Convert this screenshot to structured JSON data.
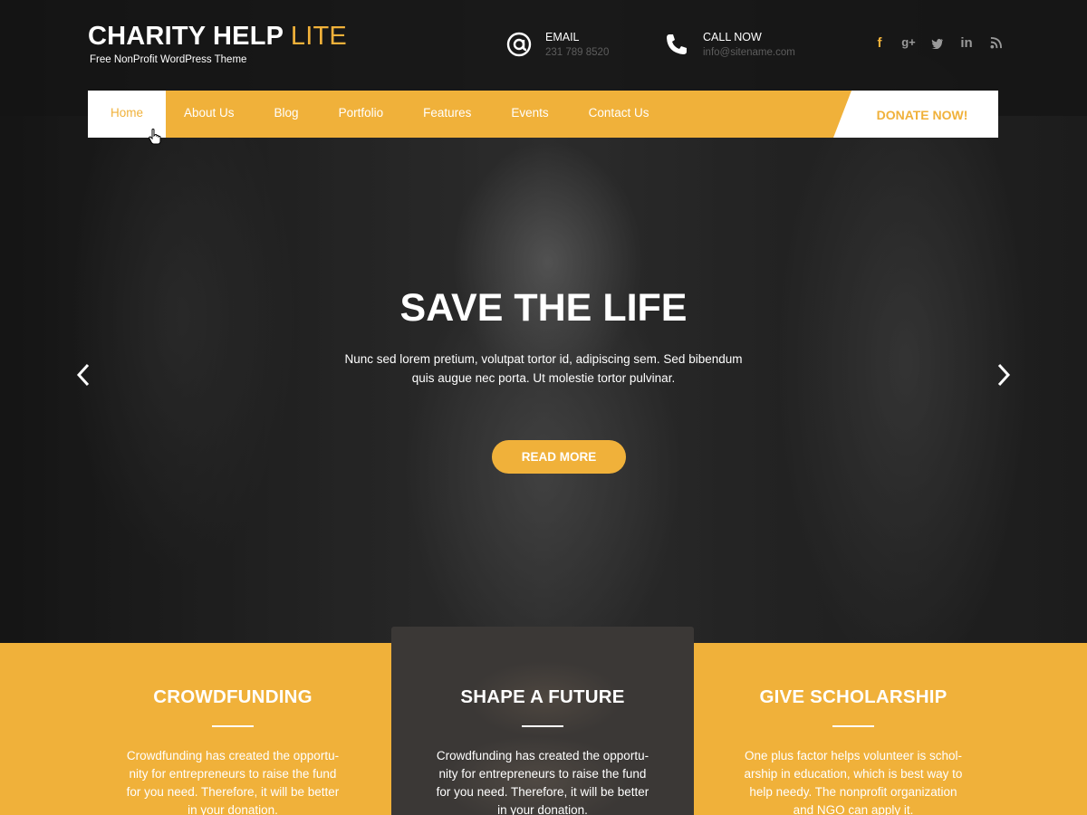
{
  "brand": {
    "title": "CHARITY HELP",
    "title_accent": "LITE",
    "tagline": "Free NonProfit WordPress Theme"
  },
  "contacts": {
    "email": {
      "label": "EMAIL",
      "value": "231 789 8520",
      "icon": "at-icon"
    },
    "call": {
      "label": "CALL NOW",
      "value": "info@sitename.com",
      "icon": "phone-icon"
    }
  },
  "social": [
    {
      "name": "facebook-icon",
      "glyph": "f"
    },
    {
      "name": "google-plus-icon",
      "glyph": "g+"
    },
    {
      "name": "twitter-icon",
      "glyph": "t"
    },
    {
      "name": "linkedin-icon",
      "glyph": "in"
    },
    {
      "name": "rss-icon",
      "glyph": "rss"
    }
  ],
  "nav": {
    "items": [
      "Home",
      "About Us",
      "Blog",
      "Portfolio",
      "Features",
      "Events",
      "Contact Us"
    ],
    "donate": "DONATE NOW!"
  },
  "hero": {
    "title": "SAVE THE LIFE",
    "text": "Nunc sed lorem pretium, volutpat tortor id, adipiscing sem. Sed bibendum quis augue nec porta. Ut molestie tortor pulvinar.",
    "button": "READ MORE"
  },
  "features": [
    {
      "title": "CROWDFUNDING",
      "text": "Crowdfunding has created the opportu-nity for entrepreneurs to raise the fund for you need. Therefore, it will be better in your donation."
    },
    {
      "title": "SHAPE A FUTURE",
      "text": "Crowdfunding has created the opportu-nity for entrepreneurs to raise the fund for you need. Therefore, it will be better in your donation."
    },
    {
      "title": "GIVE SCHOLARSHIP",
      "text": "One plus factor helps volunteer is schol-arship in education, which is best way to help needy. The nonprofit organization and NGO can apply it."
    }
  ],
  "colors": {
    "accent": "#f0b13a",
    "header_bg": "#1a1a1a",
    "muted_text": "#5d5d5d"
  }
}
